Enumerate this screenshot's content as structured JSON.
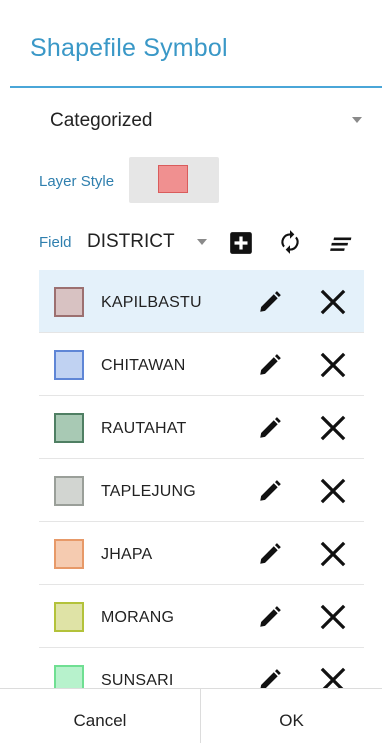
{
  "dialog": {
    "title": "Shapefile Symbol"
  },
  "renderer": {
    "selected": "Categorized"
  },
  "layer_style": {
    "label": "Layer Style",
    "fill_color": "#f09090",
    "border_color": "#d95c5c"
  },
  "field": {
    "label": "Field",
    "value": "DISTRICT",
    "actions": {
      "add": "plus-box-icon",
      "refresh": "refresh-icon",
      "sort": "sort-lines-icon"
    }
  },
  "categories": [
    {
      "label": "KAPILBASTU",
      "fill": "#d8c2c2",
      "border": "#9c7070",
      "selected": true
    },
    {
      "label": "CHITAWAN",
      "fill": "#c0d2f2",
      "border": "#5f86d6",
      "selected": false
    },
    {
      "label": "RAUTAHAT",
      "fill": "#a8c9b4",
      "border": "#4f7f63",
      "selected": false
    },
    {
      "label": "TAPLEJUNG",
      "fill": "#d2d5d1",
      "border": "#9a9f99",
      "selected": false
    },
    {
      "label": "JHAPA",
      "fill": "#f5cbb0",
      "border": "#e79968",
      "selected": false
    },
    {
      "label": "MORANG",
      "fill": "#dfe3a6",
      "border": "#b3c23a",
      "selected": false
    },
    {
      "label": "SUNSARI",
      "fill": "#b7f2cc",
      "border": "#6fdf92",
      "selected": false
    }
  ],
  "footer": {
    "cancel": "Cancel",
    "ok": "OK"
  }
}
